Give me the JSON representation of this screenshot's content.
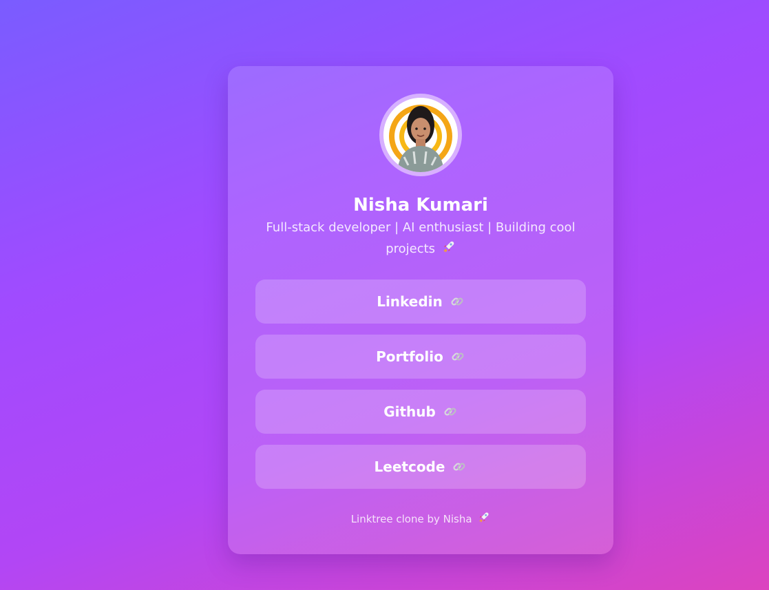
{
  "profile": {
    "name": "Nisha Kumari",
    "bio": "Full-stack developer | AI enthusiast | Building cool projects",
    "bio_icon": "rocket-icon",
    "avatar_icon": "profile-photo"
  },
  "links": [
    {
      "label": "Linkedin",
      "icon": "link-icon"
    },
    {
      "label": "Portfolio",
      "icon": "link-icon"
    },
    {
      "label": "Github",
      "icon": "link-icon"
    },
    {
      "label": "Leetcode",
      "icon": "link-icon"
    }
  ],
  "footer": {
    "text": "Linktree clone by Nisha",
    "icon": "rocket-icon"
  },
  "colors": {
    "background_start": "#7a5cff",
    "background_end": "#dc44bf",
    "text": "#ffffff"
  }
}
